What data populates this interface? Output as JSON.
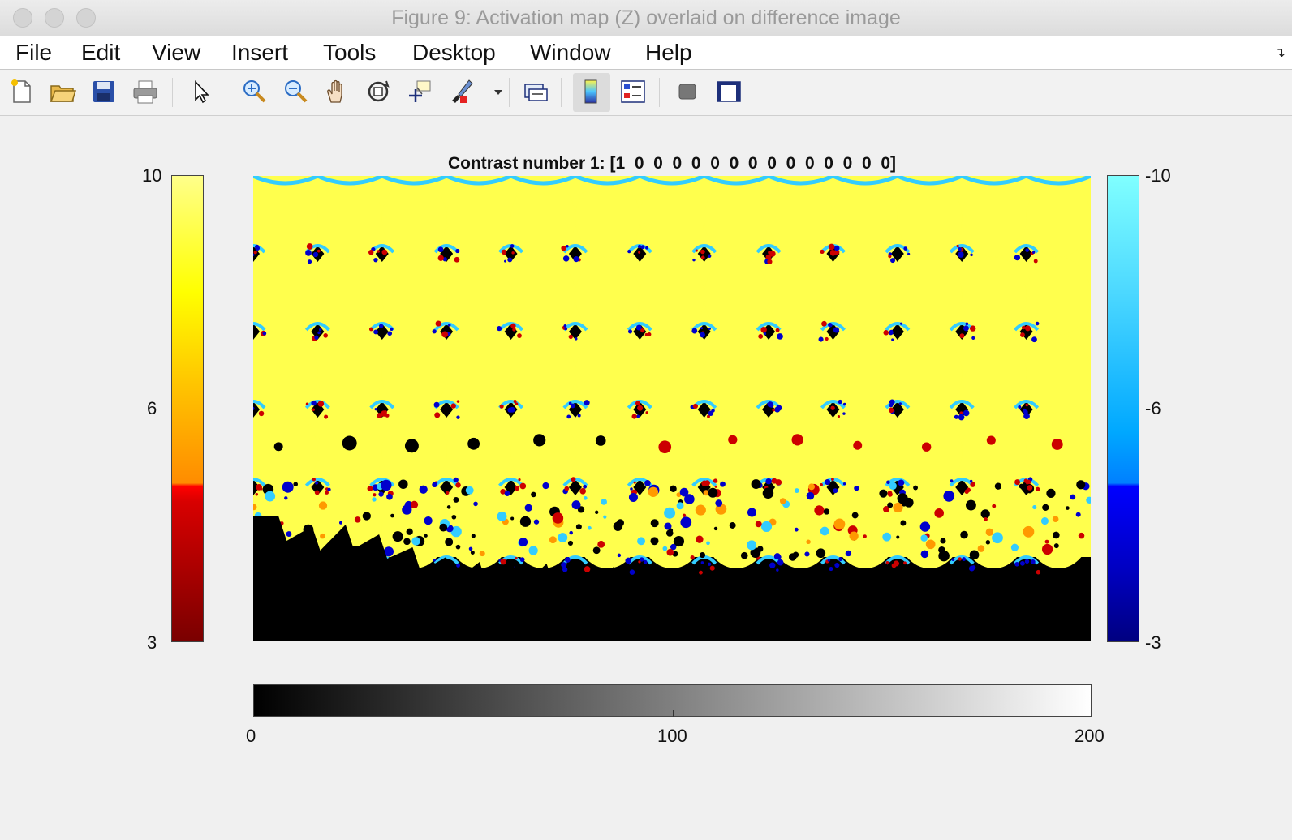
{
  "window": {
    "title": "Figure 9: Activation map (Z) overlaid on difference image"
  },
  "menu": {
    "items": [
      "File",
      "Edit",
      "View",
      "Insert",
      "Tools",
      "Desktop",
      "Window",
      "Help"
    ]
  },
  "toolbar": {
    "icons": [
      "new-figure-icon",
      "open-file-icon",
      "save-icon",
      "print-icon",
      "pointer-icon",
      "zoom-in-icon",
      "zoom-out-icon",
      "pan-hand-icon",
      "rotate-3d-icon",
      "data-cursor-icon",
      "brush-icon",
      "brush-dropdown-icon",
      "link-plot-icon",
      "colorbar-icon",
      "legend-icon",
      "hide-plot-tools-icon",
      "show-plot-tools-icon"
    ]
  },
  "figure": {
    "title": "Contrast number 1: [1  0  0  0  0  0  0  0  0  0  0  0  0  0  0]",
    "positive_colorbar": {
      "ticks": [
        "10",
        "6",
        "3"
      ],
      "range": [
        3,
        10
      ],
      "colors": [
        "#7a0000",
        "#ff0000",
        "#ff8c00",
        "#ffff00",
        "#ffff80"
      ]
    },
    "negative_colorbar": {
      "ticks": [
        "-10",
        "-6",
        "-3"
      ],
      "range": [
        -10,
        -3
      ],
      "colors": [
        "#80ffff",
        "#00a0ff",
        "#0000ff",
        "#000080"
      ]
    },
    "grayscale_colorbar": {
      "ticks": [
        "0",
        "100",
        "200"
      ],
      "range": [
        0,
        200
      ],
      "colors": [
        "#000000",
        "#ffffff"
      ]
    },
    "montage": {
      "rows": 6,
      "cols": 13,
      "overlay_colors": {
        "background": "#000000",
        "positive_high": "#ffff4d",
        "positive_mid": "#ff9900",
        "positive_low": "#cc0000",
        "negative_high": "#33ccff",
        "negative_low": "#0000cc"
      }
    }
  }
}
